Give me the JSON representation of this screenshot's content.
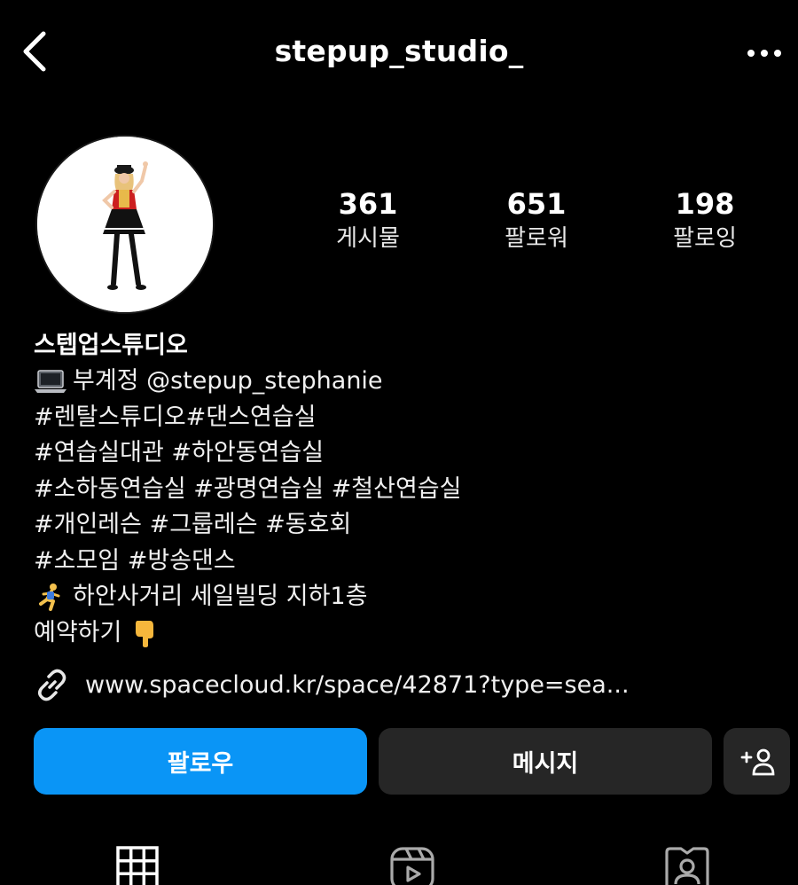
{
  "header": {
    "username": "stepup_studio_",
    "back_icon": "chevron-left-icon",
    "more_icon": "more-horizontal-icon"
  },
  "profile": {
    "stats": [
      {
        "value": "361",
        "label": "게시물"
      },
      {
        "value": "651",
        "label": "팔로워"
      },
      {
        "value": "198",
        "label": "팔로잉"
      }
    ]
  },
  "bio": {
    "display_name": "스텝업스튜디오",
    "lines": [
      "부계정 @stepup_stephanie",
      "#렌탈스튜디오#댄스연습실",
      "#연습실대관 #하안동연습실",
      "#소하동연습실 #광명연습실 #철산연습실",
      "#개인레슨 #그룹레슨 #동호회",
      "#소모임 #방송댄스",
      "하안사거리 세일빌딩 지하1층",
      "예약하기"
    ],
    "link": "www.spacecloud.kr/space/42871?type=sea..."
  },
  "actions": {
    "follow_label": "팔로우",
    "message_label": "메시지",
    "add_user_icon": "add-person-icon"
  },
  "tabs": [
    {
      "icon": "grid-icon"
    },
    {
      "icon": "reels-icon"
    },
    {
      "icon": "tagged-icon"
    }
  ],
  "colors": {
    "background": "#000000",
    "follow_button": "#0a95f6",
    "secondary_button": "#262626"
  }
}
